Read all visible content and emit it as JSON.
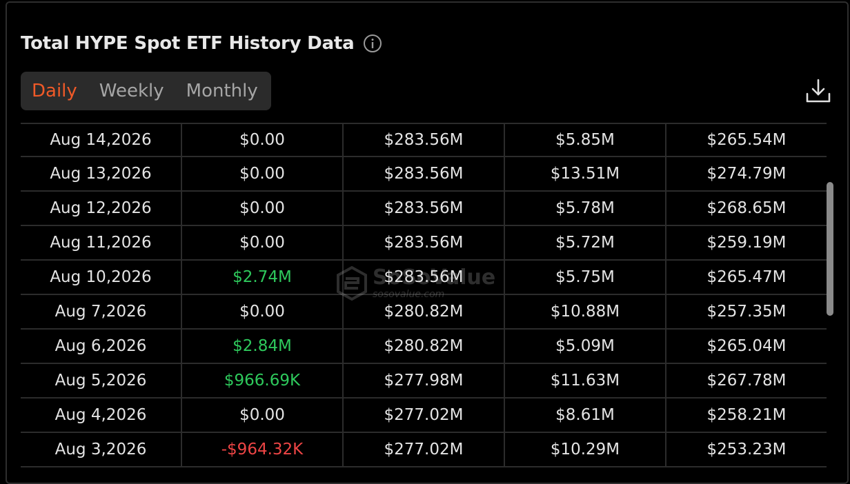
{
  "header": {
    "title": "Total HYPE Spot ETF History Data"
  },
  "tabs": [
    {
      "label": "Daily",
      "active": true
    },
    {
      "label": "Weekly",
      "active": false
    },
    {
      "label": "Monthly",
      "active": false
    }
  ],
  "watermark": {
    "name": "SoSoValue",
    "url": "sosovalue.com"
  },
  "colors": {
    "accent": "#f05a28",
    "positive": "#2ec95c",
    "negative": "#ee4545"
  },
  "table": {
    "rows": [
      {
        "date": "Aug 14,2026",
        "net_inflow": "$0.00",
        "cum_inflow": "$283.56M",
        "value_traded": "$5.85M",
        "net_assets": "$265.54M",
        "flow": "neutral"
      },
      {
        "date": "Aug 13,2026",
        "net_inflow": "$0.00",
        "cum_inflow": "$283.56M",
        "value_traded": "$13.51M",
        "net_assets": "$274.79M",
        "flow": "neutral"
      },
      {
        "date": "Aug 12,2026",
        "net_inflow": "$0.00",
        "cum_inflow": "$283.56M",
        "value_traded": "$5.78M",
        "net_assets": "$268.65M",
        "flow": "neutral"
      },
      {
        "date": "Aug 11,2026",
        "net_inflow": "$0.00",
        "cum_inflow": "$283.56M",
        "value_traded": "$5.72M",
        "net_assets": "$259.19M",
        "flow": "neutral"
      },
      {
        "date": "Aug 10,2026",
        "net_inflow": "$2.74M",
        "cum_inflow": "$283.56M",
        "value_traded": "$5.75M",
        "net_assets": "$265.47M",
        "flow": "pos"
      },
      {
        "date": "Aug 7,2026",
        "net_inflow": "$0.00",
        "cum_inflow": "$280.82M",
        "value_traded": "$10.88M",
        "net_assets": "$257.35M",
        "flow": "neutral"
      },
      {
        "date": "Aug 6,2026",
        "net_inflow": "$2.84M",
        "cum_inflow": "$280.82M",
        "value_traded": "$5.09M",
        "net_assets": "$265.04M",
        "flow": "pos"
      },
      {
        "date": "Aug 5,2026",
        "net_inflow": "$966.69K",
        "cum_inflow": "$277.98M",
        "value_traded": "$11.63M",
        "net_assets": "$267.78M",
        "flow": "pos"
      },
      {
        "date": "Aug 4,2026",
        "net_inflow": "$0.00",
        "cum_inflow": "$277.02M",
        "value_traded": "$8.61M",
        "net_assets": "$258.21M",
        "flow": "neutral"
      },
      {
        "date": "Aug 3,2026",
        "net_inflow": "-$964.32K",
        "cum_inflow": "$277.02M",
        "value_traded": "$10.29M",
        "net_assets": "$253.23M",
        "flow": "neg"
      }
    ]
  }
}
